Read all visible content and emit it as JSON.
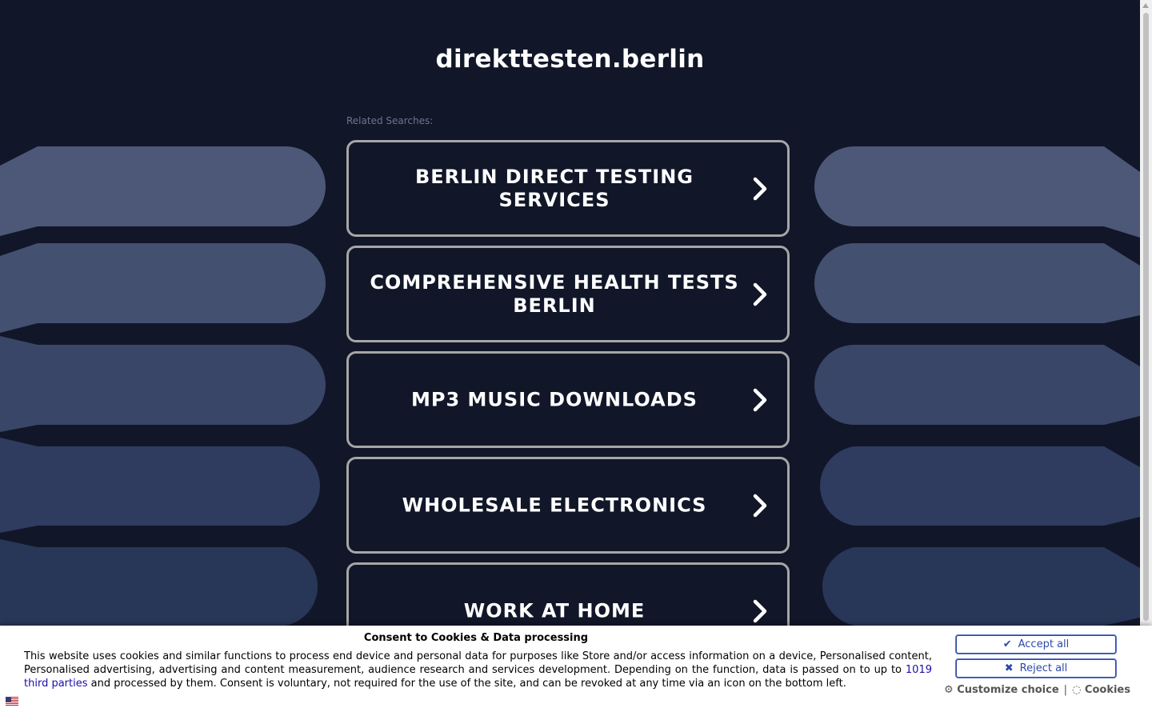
{
  "site": {
    "title": "direkttesten.berlin"
  },
  "related": {
    "label": "Related Searches:",
    "links": [
      "BERLIN DIRECT TESTING SERVICES",
      "COMPREHENSIVE HEALTH TESTS BERLIN",
      "MP3 MUSIC DOWNLOADS",
      "WHOLESALE ELECTRONICS",
      "WORK AT HOME"
    ]
  },
  "consent": {
    "title": "Consent to Cookies & Data processing",
    "body_before_link": "This website uses cookies and similar functions to process end device and personal data for purposes like Store and/or access information on a device, Personalised content, Personalised advertising, advertising and content measurement, audience research and services development. Depending on the function, data is passed on to up to ",
    "link_text": "1019 third parties",
    "body_after_link": " and processed by them. Consent is voluntary, not required for the use of the site, and can be revoked at any time via an icon on the bottom left.",
    "accept_label": "Accept all",
    "reject_label": "Reject all",
    "customize_label": "Customize choice",
    "cookies_label": "Cookies",
    "separator": "|"
  },
  "icons": {
    "link_chevron": "chevron-right-icon",
    "accept": "check-icon",
    "reject": "x-icon",
    "customize": "gear-icon",
    "cookies": "cookie-icon",
    "language": "us-flag-icon"
  },
  "colors": {
    "background": "#111729",
    "link_border": "#a6a6a6",
    "button_accent": "#2c4aa6",
    "link_color": "#1a0dab"
  }
}
